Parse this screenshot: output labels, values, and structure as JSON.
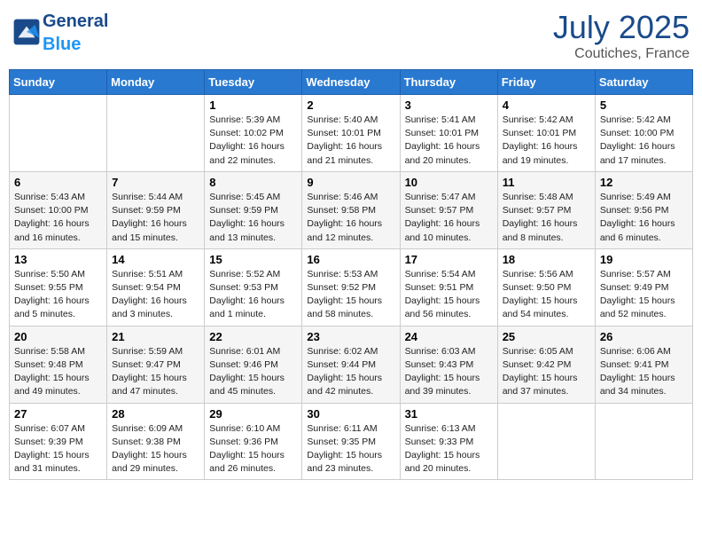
{
  "header": {
    "logo_general": "General",
    "logo_blue": "Blue",
    "month_year": "July 2025",
    "location": "Coutiches, France"
  },
  "weekdays": [
    "Sunday",
    "Monday",
    "Tuesday",
    "Wednesday",
    "Thursday",
    "Friday",
    "Saturday"
  ],
  "weeks": [
    [
      {
        "day": "",
        "info": ""
      },
      {
        "day": "",
        "info": ""
      },
      {
        "day": "1",
        "info": "Sunrise: 5:39 AM\nSunset: 10:02 PM\nDaylight: 16 hours\nand 22 minutes."
      },
      {
        "day": "2",
        "info": "Sunrise: 5:40 AM\nSunset: 10:01 PM\nDaylight: 16 hours\nand 21 minutes."
      },
      {
        "day": "3",
        "info": "Sunrise: 5:41 AM\nSunset: 10:01 PM\nDaylight: 16 hours\nand 20 minutes."
      },
      {
        "day": "4",
        "info": "Sunrise: 5:42 AM\nSunset: 10:01 PM\nDaylight: 16 hours\nand 19 minutes."
      },
      {
        "day": "5",
        "info": "Sunrise: 5:42 AM\nSunset: 10:00 PM\nDaylight: 16 hours\nand 17 minutes."
      }
    ],
    [
      {
        "day": "6",
        "info": "Sunrise: 5:43 AM\nSunset: 10:00 PM\nDaylight: 16 hours\nand 16 minutes."
      },
      {
        "day": "7",
        "info": "Sunrise: 5:44 AM\nSunset: 9:59 PM\nDaylight: 16 hours\nand 15 minutes."
      },
      {
        "day": "8",
        "info": "Sunrise: 5:45 AM\nSunset: 9:59 PM\nDaylight: 16 hours\nand 13 minutes."
      },
      {
        "day": "9",
        "info": "Sunrise: 5:46 AM\nSunset: 9:58 PM\nDaylight: 16 hours\nand 12 minutes."
      },
      {
        "day": "10",
        "info": "Sunrise: 5:47 AM\nSunset: 9:57 PM\nDaylight: 16 hours\nand 10 minutes."
      },
      {
        "day": "11",
        "info": "Sunrise: 5:48 AM\nSunset: 9:57 PM\nDaylight: 16 hours\nand 8 minutes."
      },
      {
        "day": "12",
        "info": "Sunrise: 5:49 AM\nSunset: 9:56 PM\nDaylight: 16 hours\nand 6 minutes."
      }
    ],
    [
      {
        "day": "13",
        "info": "Sunrise: 5:50 AM\nSunset: 9:55 PM\nDaylight: 16 hours\nand 5 minutes."
      },
      {
        "day": "14",
        "info": "Sunrise: 5:51 AM\nSunset: 9:54 PM\nDaylight: 16 hours\nand 3 minutes."
      },
      {
        "day": "15",
        "info": "Sunrise: 5:52 AM\nSunset: 9:53 PM\nDaylight: 16 hours\nand 1 minute."
      },
      {
        "day": "16",
        "info": "Sunrise: 5:53 AM\nSunset: 9:52 PM\nDaylight: 15 hours\nand 58 minutes."
      },
      {
        "day": "17",
        "info": "Sunrise: 5:54 AM\nSunset: 9:51 PM\nDaylight: 15 hours\nand 56 minutes."
      },
      {
        "day": "18",
        "info": "Sunrise: 5:56 AM\nSunset: 9:50 PM\nDaylight: 15 hours\nand 54 minutes."
      },
      {
        "day": "19",
        "info": "Sunrise: 5:57 AM\nSunset: 9:49 PM\nDaylight: 15 hours\nand 52 minutes."
      }
    ],
    [
      {
        "day": "20",
        "info": "Sunrise: 5:58 AM\nSunset: 9:48 PM\nDaylight: 15 hours\nand 49 minutes."
      },
      {
        "day": "21",
        "info": "Sunrise: 5:59 AM\nSunset: 9:47 PM\nDaylight: 15 hours\nand 47 minutes."
      },
      {
        "day": "22",
        "info": "Sunrise: 6:01 AM\nSunset: 9:46 PM\nDaylight: 15 hours\nand 45 minutes."
      },
      {
        "day": "23",
        "info": "Sunrise: 6:02 AM\nSunset: 9:44 PM\nDaylight: 15 hours\nand 42 minutes."
      },
      {
        "day": "24",
        "info": "Sunrise: 6:03 AM\nSunset: 9:43 PM\nDaylight: 15 hours\nand 39 minutes."
      },
      {
        "day": "25",
        "info": "Sunrise: 6:05 AM\nSunset: 9:42 PM\nDaylight: 15 hours\nand 37 minutes."
      },
      {
        "day": "26",
        "info": "Sunrise: 6:06 AM\nSunset: 9:41 PM\nDaylight: 15 hours\nand 34 minutes."
      }
    ],
    [
      {
        "day": "27",
        "info": "Sunrise: 6:07 AM\nSunset: 9:39 PM\nDaylight: 15 hours\nand 31 minutes."
      },
      {
        "day": "28",
        "info": "Sunrise: 6:09 AM\nSunset: 9:38 PM\nDaylight: 15 hours\nand 29 minutes."
      },
      {
        "day": "29",
        "info": "Sunrise: 6:10 AM\nSunset: 9:36 PM\nDaylight: 15 hours\nand 26 minutes."
      },
      {
        "day": "30",
        "info": "Sunrise: 6:11 AM\nSunset: 9:35 PM\nDaylight: 15 hours\nand 23 minutes."
      },
      {
        "day": "31",
        "info": "Sunrise: 6:13 AM\nSunset: 9:33 PM\nDaylight: 15 hours\nand 20 minutes."
      },
      {
        "day": "",
        "info": ""
      },
      {
        "day": "",
        "info": ""
      }
    ]
  ]
}
